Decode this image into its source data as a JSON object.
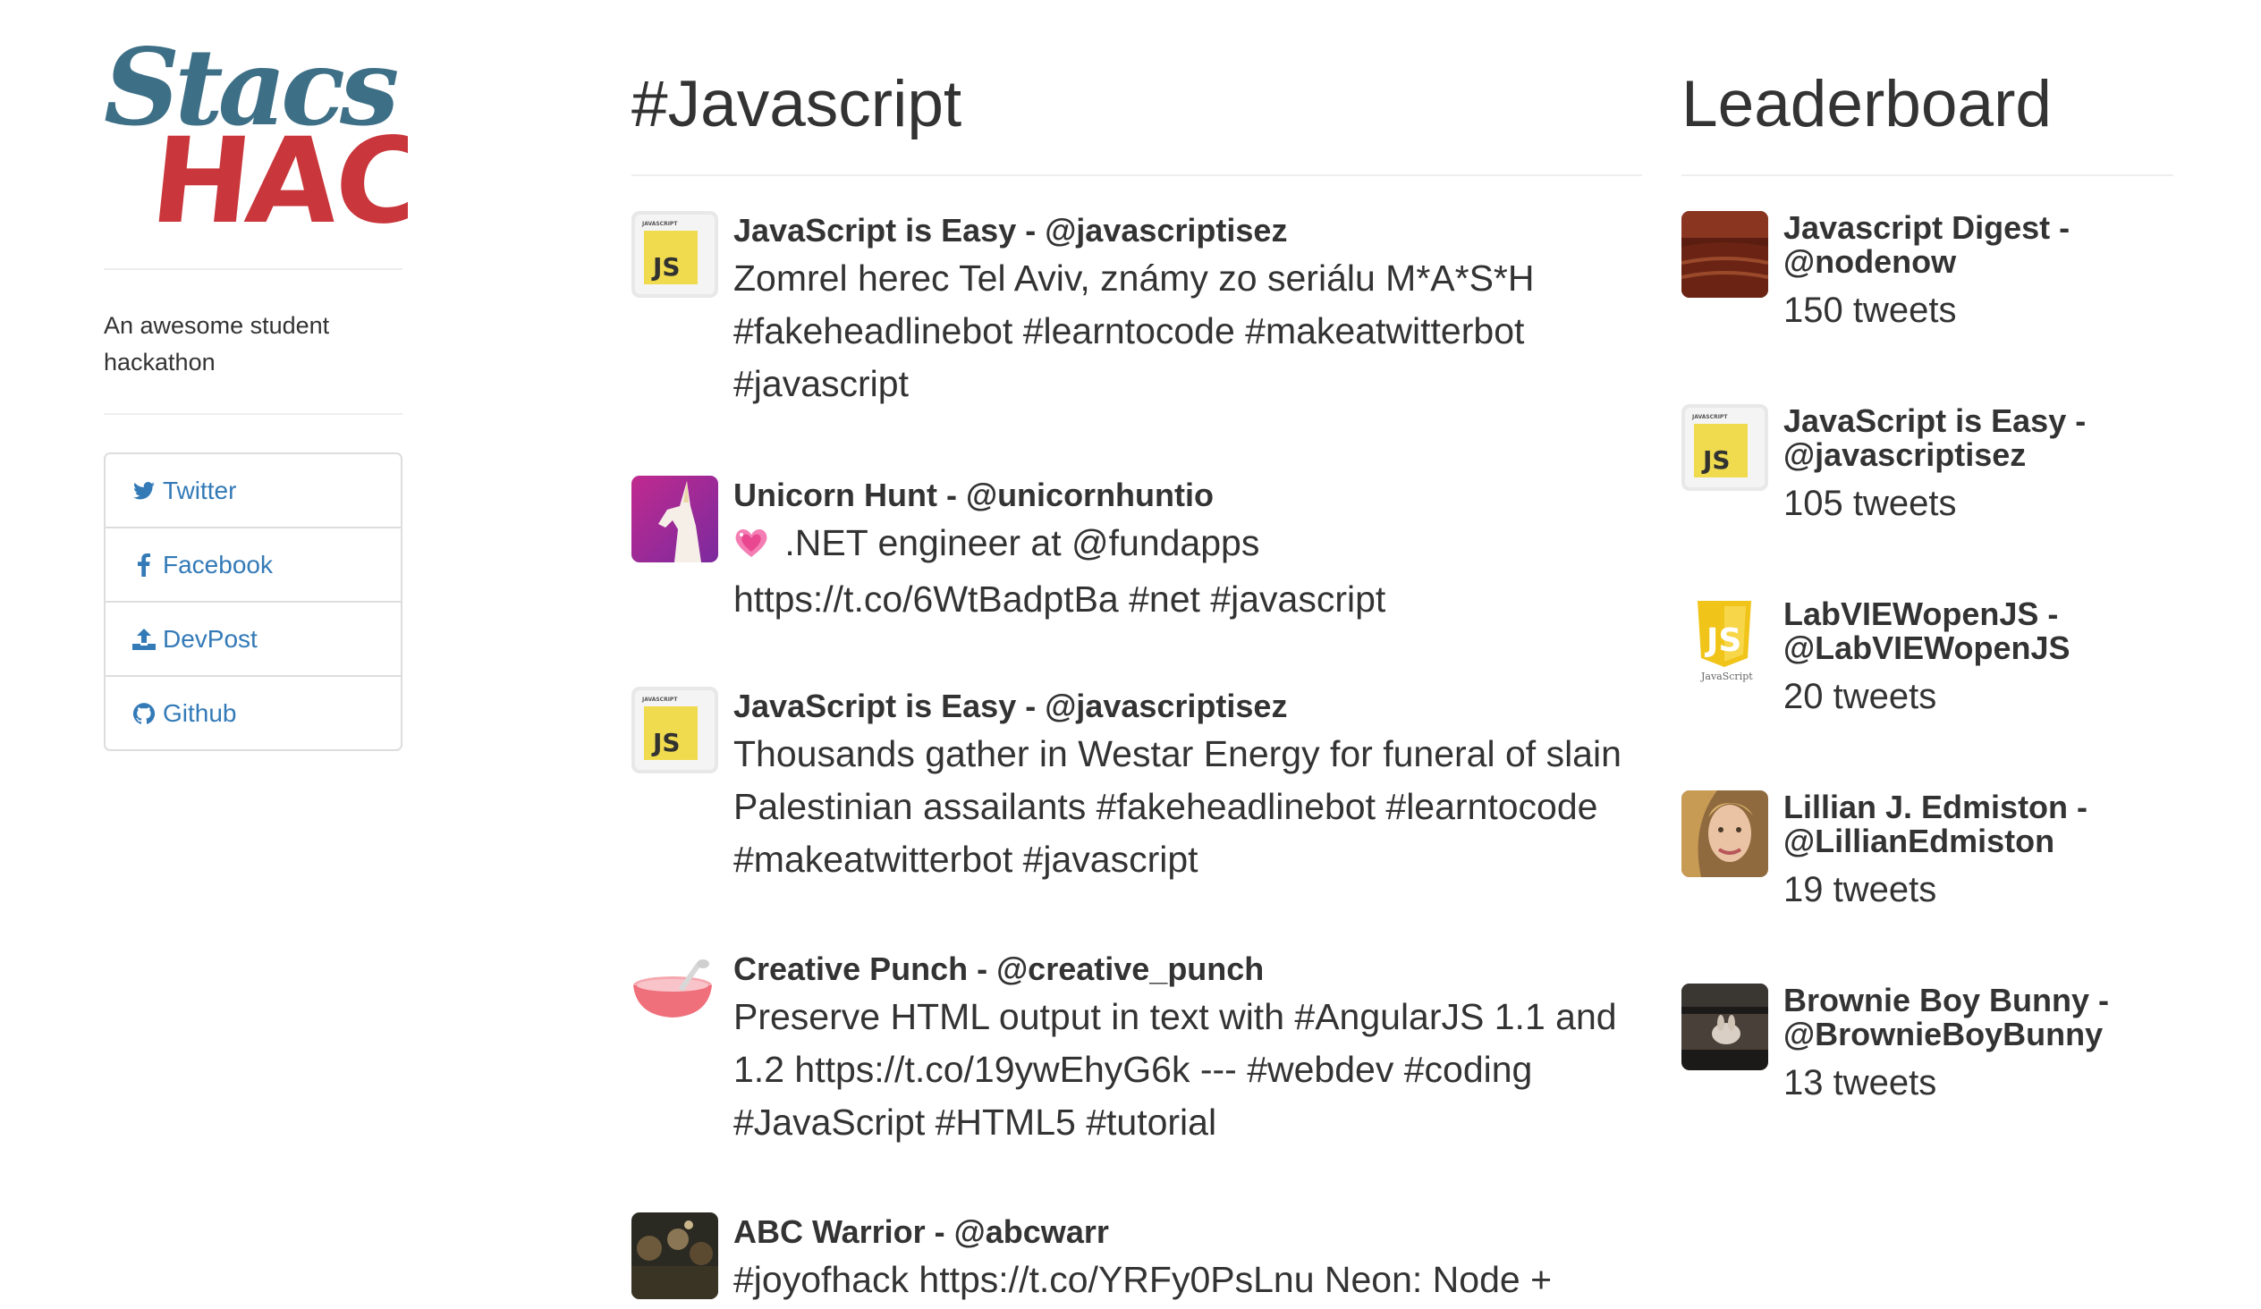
{
  "brand": {
    "logo_line1": "Stacs",
    "logo_line2": "HACK",
    "tagline": "An awesome student hackathon",
    "colors": {
      "blue": "#3d6f86",
      "red": "#c9363b"
    }
  },
  "nav": [
    {
      "label": "Twitter",
      "icon": "twitter-icon"
    },
    {
      "label": "Facebook",
      "icon": "facebook-icon"
    },
    {
      "label": "DevPost",
      "icon": "upload-icon"
    },
    {
      "label": "Github",
      "icon": "github-icon"
    }
  ],
  "feed": {
    "title": "#Javascript",
    "tweets": [
      {
        "author": "JavaScript is Easy - @javascriptisez",
        "avatar": "js-badge",
        "text": "Zomrel herec Tel Aviv, známy zo seriálu M*A*S*H #fakeheadlinebot #learntocode #makeatwitterbot #javascript"
      },
      {
        "author": "Unicorn Hunt - @unicornhuntio",
        "avatar": "unicorn",
        "emoji": "sparkling-heart-emoji",
        "text": ".NET engineer at @fundapps https://t.co/6WtBadptBa #net #javascript"
      },
      {
        "author": "JavaScript is Easy - @javascriptisez",
        "avatar": "js-badge",
        "text": "Thousands gather in Westar Energy for funeral of slain Palestinian assailants #fakeheadlinebot #learntocode #makeatwitterbot #javascript"
      },
      {
        "author": "Creative Punch - @creative_punch",
        "avatar": "punch-bowl",
        "text": "Preserve HTML output in text with #AngularJS 1.1 and 1.2 https://t.co/19ywEhyG6k --- #webdev #coding #JavaScript #HTML5 #tutorial"
      },
      {
        "author": "ABC Warrior - @abcwarr",
        "avatar": "crowd-photo",
        "text": "#joyofhack https://t.co/YRFy0PsLnu Neon: Node +"
      }
    ]
  },
  "leaderboard": {
    "title": "Leaderboard",
    "entries": [
      {
        "name": "Javascript Digest - @nodenow",
        "count": "150 tweets",
        "avatar": "theater-photo"
      },
      {
        "name": "JavaScript is Easy - @javascriptisez",
        "count": "105 tweets",
        "avatar": "js-badge"
      },
      {
        "name": "LabVIEWopenJS - @LabVIEWopenJS",
        "count": "20 tweets",
        "avatar": "js-shield"
      },
      {
        "name": "Lillian J. Edmiston - @LillianEdmiston",
        "count": "19 tweets",
        "avatar": "portrait-photo"
      },
      {
        "name": "Brownie Boy Bunny - @BrownieBoyBunny",
        "count": "13 tweets",
        "avatar": "bunny-photo"
      }
    ]
  }
}
